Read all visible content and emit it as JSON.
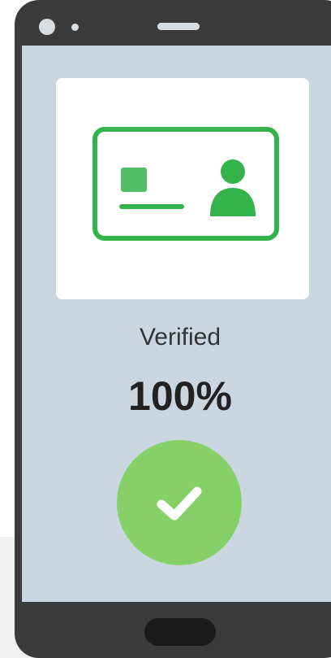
{
  "verification": {
    "label": "Verified",
    "percent": "100%",
    "progress_fraction": 1.0
  },
  "icons": {
    "id_card": "id-card-icon",
    "checkmark": "checkmark-icon"
  },
  "colors": {
    "device_frame": "#3b3b3b",
    "screen_background": "#cbd7e0",
    "id_card_stroke": "#34b34a",
    "success": "#85d168",
    "home_button": "#1a1a1a"
  }
}
